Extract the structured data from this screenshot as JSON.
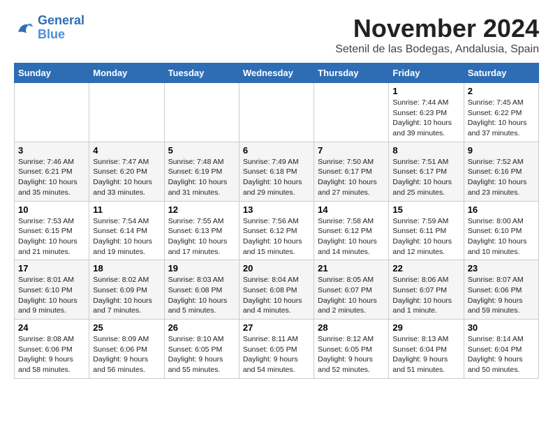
{
  "logo": {
    "line1": "General",
    "line2": "Blue"
  },
  "title": "November 2024",
  "location": "Setenil de las Bodegas, Andalusia, Spain",
  "headers": [
    "Sunday",
    "Monday",
    "Tuesday",
    "Wednesday",
    "Thursday",
    "Friday",
    "Saturday"
  ],
  "weeks": [
    [
      {
        "day": "",
        "info": ""
      },
      {
        "day": "",
        "info": ""
      },
      {
        "day": "",
        "info": ""
      },
      {
        "day": "",
        "info": ""
      },
      {
        "day": "",
        "info": ""
      },
      {
        "day": "1",
        "info": "Sunrise: 7:44 AM\nSunset: 6:23 PM\nDaylight: 10 hours and 39 minutes."
      },
      {
        "day": "2",
        "info": "Sunrise: 7:45 AM\nSunset: 6:22 PM\nDaylight: 10 hours and 37 minutes."
      }
    ],
    [
      {
        "day": "3",
        "info": "Sunrise: 7:46 AM\nSunset: 6:21 PM\nDaylight: 10 hours and 35 minutes."
      },
      {
        "day": "4",
        "info": "Sunrise: 7:47 AM\nSunset: 6:20 PM\nDaylight: 10 hours and 33 minutes."
      },
      {
        "day": "5",
        "info": "Sunrise: 7:48 AM\nSunset: 6:19 PM\nDaylight: 10 hours and 31 minutes."
      },
      {
        "day": "6",
        "info": "Sunrise: 7:49 AM\nSunset: 6:18 PM\nDaylight: 10 hours and 29 minutes."
      },
      {
        "day": "7",
        "info": "Sunrise: 7:50 AM\nSunset: 6:17 PM\nDaylight: 10 hours and 27 minutes."
      },
      {
        "day": "8",
        "info": "Sunrise: 7:51 AM\nSunset: 6:17 PM\nDaylight: 10 hours and 25 minutes."
      },
      {
        "day": "9",
        "info": "Sunrise: 7:52 AM\nSunset: 6:16 PM\nDaylight: 10 hours and 23 minutes."
      }
    ],
    [
      {
        "day": "10",
        "info": "Sunrise: 7:53 AM\nSunset: 6:15 PM\nDaylight: 10 hours and 21 minutes."
      },
      {
        "day": "11",
        "info": "Sunrise: 7:54 AM\nSunset: 6:14 PM\nDaylight: 10 hours and 19 minutes."
      },
      {
        "day": "12",
        "info": "Sunrise: 7:55 AM\nSunset: 6:13 PM\nDaylight: 10 hours and 17 minutes."
      },
      {
        "day": "13",
        "info": "Sunrise: 7:56 AM\nSunset: 6:12 PM\nDaylight: 10 hours and 15 minutes."
      },
      {
        "day": "14",
        "info": "Sunrise: 7:58 AM\nSunset: 6:12 PM\nDaylight: 10 hours and 14 minutes."
      },
      {
        "day": "15",
        "info": "Sunrise: 7:59 AM\nSunset: 6:11 PM\nDaylight: 10 hours and 12 minutes."
      },
      {
        "day": "16",
        "info": "Sunrise: 8:00 AM\nSunset: 6:10 PM\nDaylight: 10 hours and 10 minutes."
      }
    ],
    [
      {
        "day": "17",
        "info": "Sunrise: 8:01 AM\nSunset: 6:10 PM\nDaylight: 10 hours and 9 minutes."
      },
      {
        "day": "18",
        "info": "Sunrise: 8:02 AM\nSunset: 6:09 PM\nDaylight: 10 hours and 7 minutes."
      },
      {
        "day": "19",
        "info": "Sunrise: 8:03 AM\nSunset: 6:08 PM\nDaylight: 10 hours and 5 minutes."
      },
      {
        "day": "20",
        "info": "Sunrise: 8:04 AM\nSunset: 6:08 PM\nDaylight: 10 hours and 4 minutes."
      },
      {
        "day": "21",
        "info": "Sunrise: 8:05 AM\nSunset: 6:07 PM\nDaylight: 10 hours and 2 minutes."
      },
      {
        "day": "22",
        "info": "Sunrise: 8:06 AM\nSunset: 6:07 PM\nDaylight: 10 hours and 1 minute."
      },
      {
        "day": "23",
        "info": "Sunrise: 8:07 AM\nSunset: 6:06 PM\nDaylight: 9 hours and 59 minutes."
      }
    ],
    [
      {
        "day": "24",
        "info": "Sunrise: 8:08 AM\nSunset: 6:06 PM\nDaylight: 9 hours and 58 minutes."
      },
      {
        "day": "25",
        "info": "Sunrise: 8:09 AM\nSunset: 6:06 PM\nDaylight: 9 hours and 56 minutes."
      },
      {
        "day": "26",
        "info": "Sunrise: 8:10 AM\nSunset: 6:05 PM\nDaylight: 9 hours and 55 minutes."
      },
      {
        "day": "27",
        "info": "Sunrise: 8:11 AM\nSunset: 6:05 PM\nDaylight: 9 hours and 54 minutes."
      },
      {
        "day": "28",
        "info": "Sunrise: 8:12 AM\nSunset: 6:05 PM\nDaylight: 9 hours and 52 minutes."
      },
      {
        "day": "29",
        "info": "Sunrise: 8:13 AM\nSunset: 6:04 PM\nDaylight: 9 hours and 51 minutes."
      },
      {
        "day": "30",
        "info": "Sunrise: 8:14 AM\nSunset: 6:04 PM\nDaylight: 9 hours and 50 minutes."
      }
    ]
  ]
}
